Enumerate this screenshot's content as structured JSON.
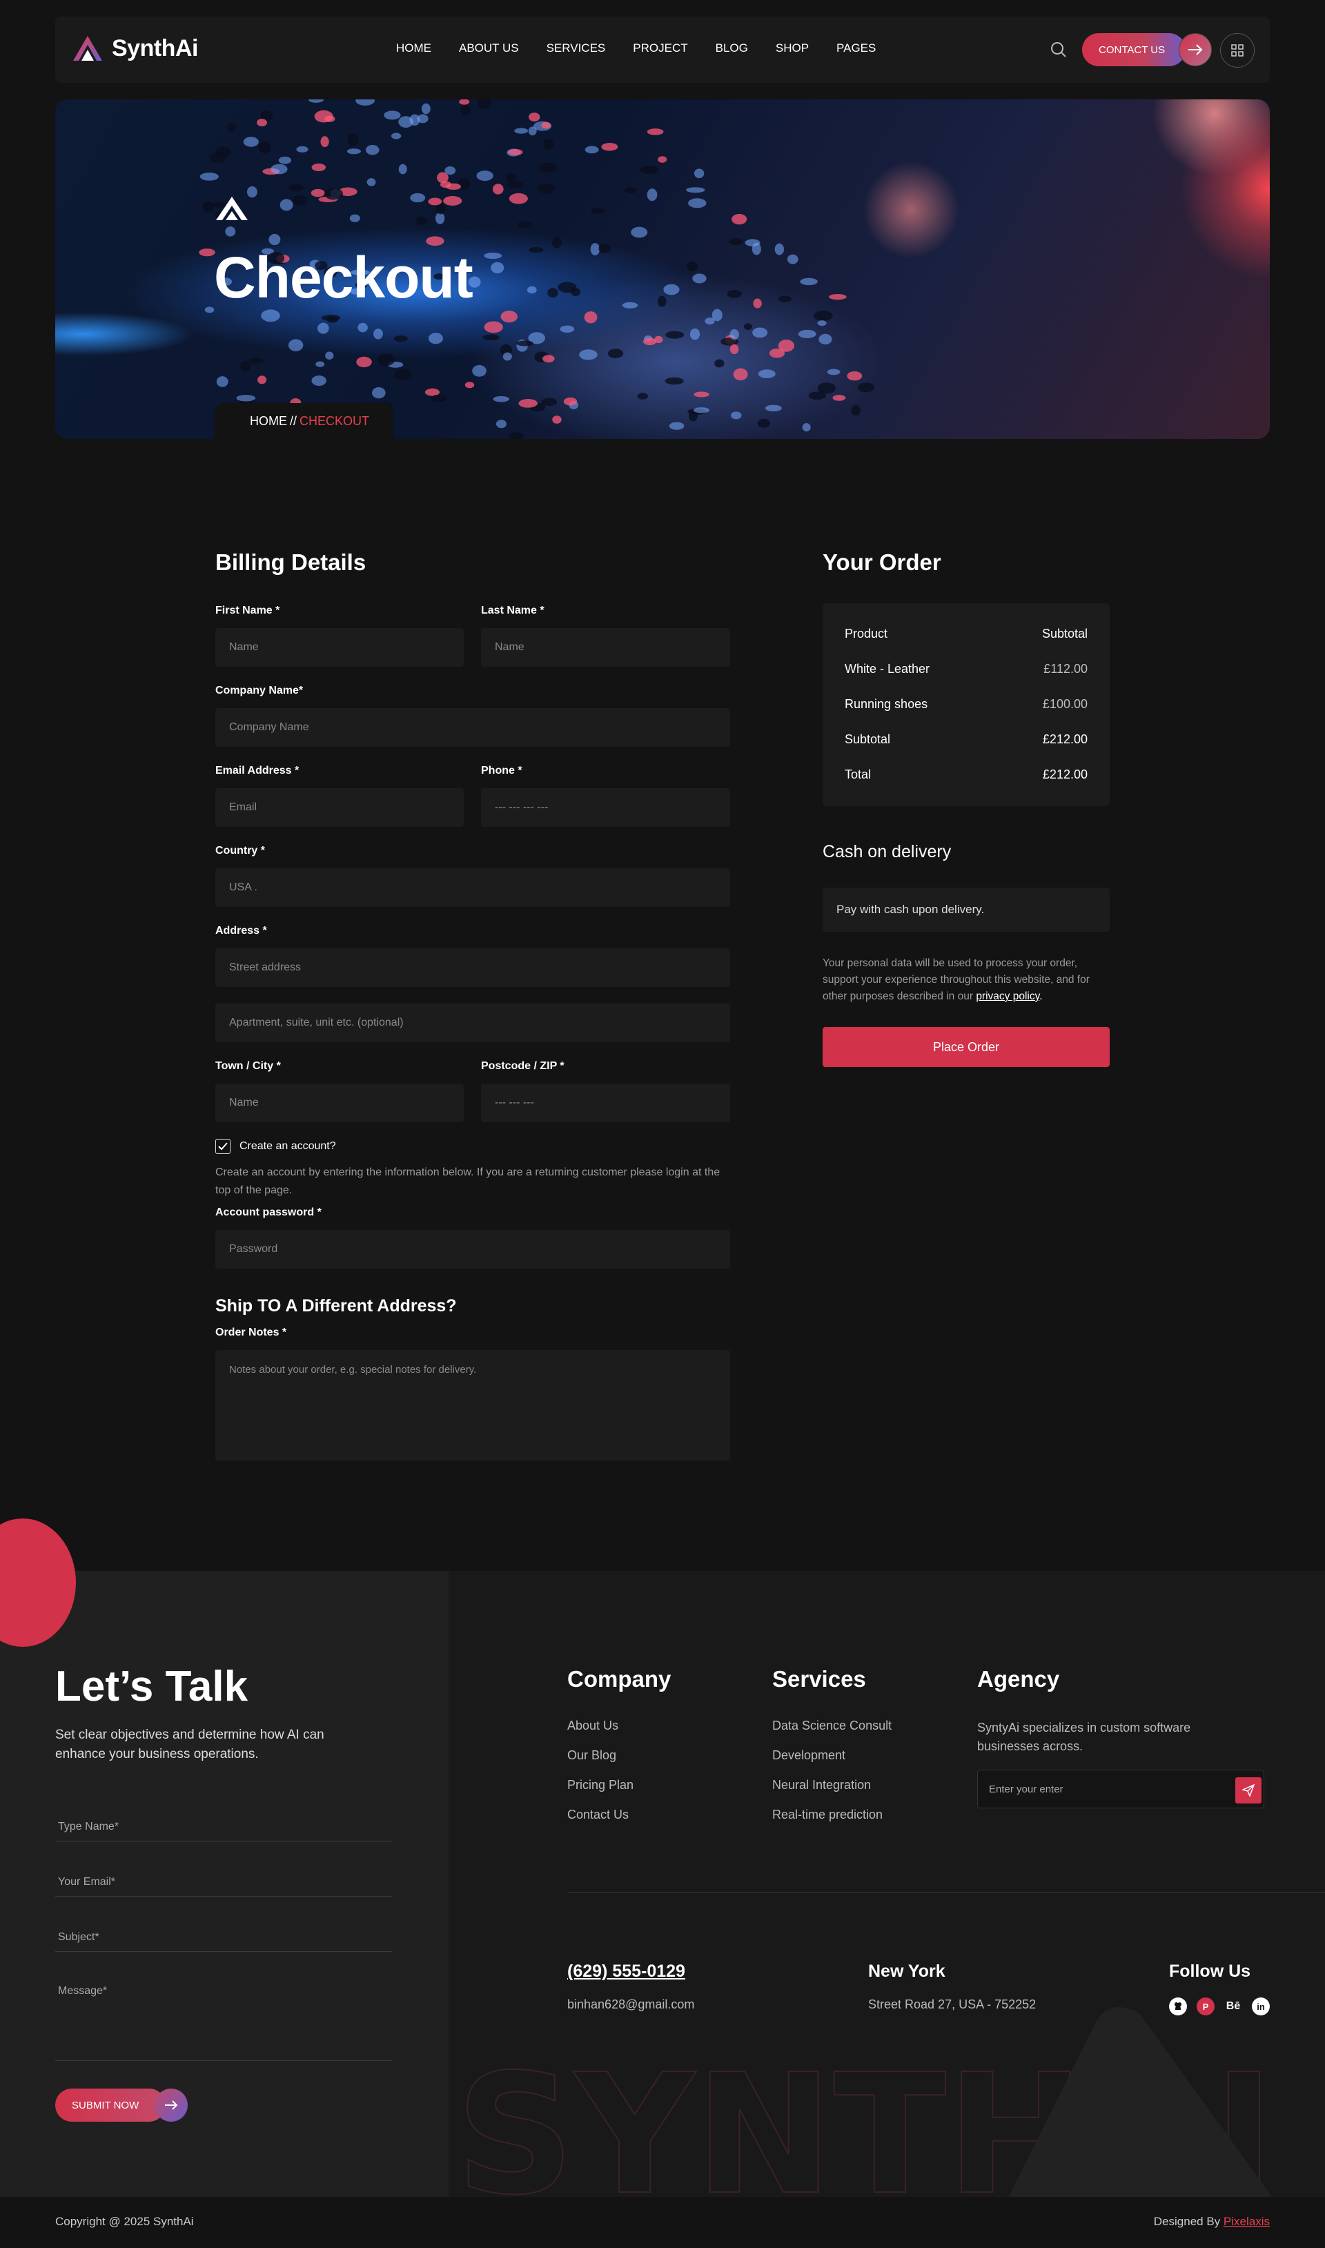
{
  "nav": {
    "logo_text": "SynthAi",
    "menu": [
      "HOME",
      "ABOUT US",
      "SERVICES",
      "PROJECT",
      "BLOG",
      "SHOP",
      "PAGES"
    ],
    "contact_label": "CONTACT US"
  },
  "hero": {
    "title": "Checkout",
    "crumb_home": "HOME",
    "crumb_sep": "//",
    "crumb_current": "CHECKOUT"
  },
  "billing": {
    "title": "Billing Details",
    "first_name_label": "First Name *",
    "first_name_ph": "Name",
    "last_name_label": "Last Name *",
    "last_name_ph": "Name",
    "company_label": "Company Name*",
    "company_ph": "Company Name",
    "email_label": "Email Address *",
    "email_ph": "Email",
    "phone_label": "Phone *",
    "phone_ph": "--- --- --- ---",
    "country_label": "Country *",
    "country_value": "USA .",
    "address_label": "Address *",
    "street_ph": "Street address",
    "apt_ph": "Apartment, suite, unit etc. (optional)",
    "town_label": "Town / City *",
    "town_ph": "Name",
    "postcode_label": "Postcode / ZIP *",
    "postcode_ph": "--- --- ---",
    "create_account_label": "Create an account?",
    "create_account_note": "Create an account by entering the information below. If you are a returning customer please login at the top of the page.",
    "password_label": "Account password *",
    "password_ph": "Password",
    "ship_title": "Ship TO A Different Address?",
    "order_notes_label": "Order Notes *",
    "order_notes_ph": "Notes about your order, e.g. special notes for delivery."
  },
  "order": {
    "title": "Your Order",
    "header_product": "Product",
    "header_subtotal": "Subtotal",
    "items": [
      {
        "name": "White - Leather",
        "price": "£112.00"
      },
      {
        "name": "Running shoes",
        "price": "£100.00"
      }
    ],
    "subtotal_label": "Subtotal",
    "subtotal_value": "£212.00",
    "total_label": "Total",
    "total_value": "£212.00",
    "payment_title": "Cash on delivery",
    "payment_note": "Pay with cash upon delivery.",
    "privacy_text": "Your personal data will be used to process your order, support your experience throughout this website, and for other purposes described in our",
    "privacy_link": "privacy policy",
    "place_order": "Place Order"
  },
  "footer": {
    "talk_title": "Let’s Talk",
    "talk_sub": "Set clear objectives and determine how AI can enhance your business operations.",
    "form": [
      "Type Name*",
      "Your Email*",
      "Subject*",
      "Message*"
    ],
    "submit": "SUBMIT NOW",
    "company_title": "Company",
    "company_links": [
      "About Us",
      "Our Blog",
      "Pricing Plan",
      "Contact Us"
    ],
    "services_title": "Services",
    "services_links": [
      "Data Science Consult",
      "Development",
      "Neural Integration",
      "Real-time prediction"
    ],
    "agency_title": "Agency",
    "agency_text": "SyntyAi specializes in custom software businesses across.",
    "newsletter_ph": "Enter your enter",
    "phone": "(629) 555-0129",
    "email": "binhan628@gmail.com",
    "city": "New York",
    "street": "Street Road 27, USA - 752252",
    "follow_title": "Follow Us",
    "watermark": "SYNTHAI",
    "copyright": "Copyright @ 2025 SynthAi",
    "designed_by": "Designed By",
    "designer": "Pixelaxis"
  },
  "colors": {
    "accent": "#d2324a",
    "bg": "#131313",
    "panel": "#1c1c1c",
    "purple": "#6a5cc8"
  }
}
